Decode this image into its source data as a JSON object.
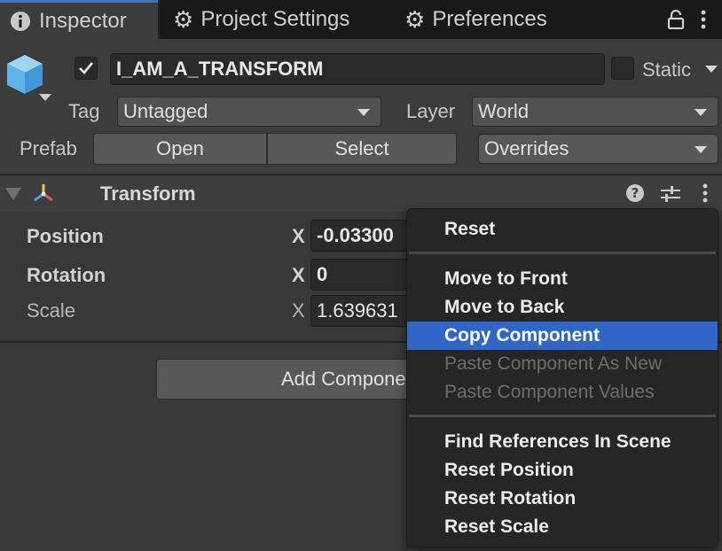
{
  "tabs": [
    {
      "label": "Inspector",
      "icon": "info-icon",
      "active": true
    },
    {
      "label": "Project Settings",
      "icon": "gear-icon",
      "active": false
    },
    {
      "label": "Preferences",
      "icon": "gear-icon",
      "active": false
    }
  ],
  "object": {
    "name": "I_AM_A_TRANSFORM",
    "active_checked": true,
    "static_label": "Static",
    "tag_label": "Tag",
    "tag_value": "Untagged",
    "layer_label": "Layer",
    "layer_value": "World",
    "prefab_label": "Prefab",
    "prefab_open": "Open",
    "prefab_select": "Select",
    "prefab_overrides": "Overrides"
  },
  "component": {
    "title": "Transform",
    "fields": [
      {
        "label": "Position",
        "axis": "X",
        "value": "-0.03300"
      },
      {
        "label": "Rotation",
        "axis": "X",
        "value": "0"
      },
      {
        "label": "Scale",
        "axis": "X",
        "value": "1.639631"
      }
    ]
  },
  "add_component_label": "Add Component",
  "context_menu": {
    "items": [
      {
        "label": "Reset",
        "disabled": false,
        "selected": false
      },
      {
        "label": "Move to Front",
        "disabled": false,
        "selected": false
      },
      {
        "label": "Move to Back",
        "disabled": false,
        "selected": false
      },
      {
        "label": "Copy Component",
        "disabled": false,
        "selected": true
      },
      {
        "label": "Paste Component As New",
        "disabled": true,
        "selected": false
      },
      {
        "label": "Paste Component Values",
        "disabled": true,
        "selected": false
      },
      {
        "label": "Find References In Scene",
        "disabled": false,
        "selected": false
      },
      {
        "label": "Reset Position",
        "disabled": false,
        "selected": false
      },
      {
        "label": "Reset Rotation",
        "disabled": false,
        "selected": false
      },
      {
        "label": "Reset Scale",
        "disabled": false,
        "selected": false
      }
    ]
  },
  "colors": {
    "accent": "#3a79bb",
    "selection": "#2f66c7",
    "panel": "#383838"
  }
}
